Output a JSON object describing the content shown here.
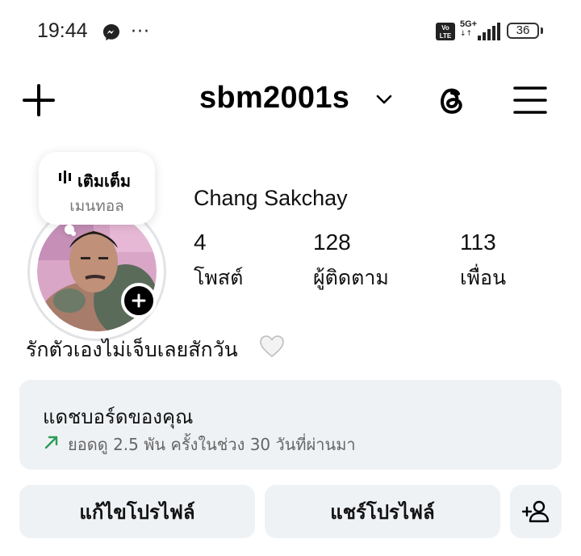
{
  "status_bar": {
    "time": "19:44",
    "messenger_icon": "messenger-icon",
    "more": "···",
    "network": "5G+",
    "network_arrows": "↓↑",
    "battery": "36"
  },
  "header": {
    "username": "sbm2001s",
    "icons": [
      "plus-icon",
      "chevron-down-icon",
      "threads-icon",
      "menu-icon"
    ]
  },
  "note": {
    "title": "เติมเต็ม",
    "subtitle": "เมนทอล"
  },
  "profile": {
    "full_name": "Chang Sakchay",
    "stats": [
      {
        "value": "4",
        "label": "โพสต์"
      },
      {
        "value": "128",
        "label": "ผู้ติดตาม"
      },
      {
        "value": "113",
        "label": "เพื่อน"
      }
    ],
    "bio": "รักตัวเองไม่เจ็บเลยสักวัน"
  },
  "dashboard": {
    "title": "แดชบอร์ดของคุณ",
    "subtitle": "ยอดดู 2.5 พัน ครั้งในช่วง 30 วันที่ผ่านมา",
    "trend_color": "#2a9d57"
  },
  "buttons": {
    "edit_profile": "แก้ไขโปรไฟล์",
    "share_profile": "แชร์โปรไฟล์"
  }
}
